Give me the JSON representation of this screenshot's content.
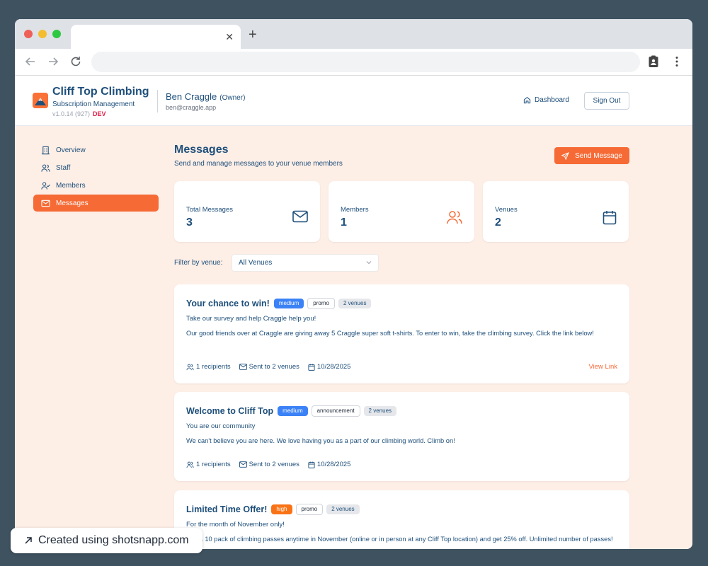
{
  "browser": {
    "tab_close": "✕",
    "new_tab": "+"
  },
  "header": {
    "brand_title": "Cliff Top Climbing",
    "brand_subtitle": "Subscription Management",
    "version": "v1.0.14 (927)",
    "env_badge": "DEV",
    "user_name": "Ben Craggle",
    "user_role": "(Owner)",
    "user_email": "ben@craggle.app",
    "dashboard_label": "Dashboard",
    "signout_label": "Sign Out"
  },
  "sidebar": {
    "items": [
      {
        "label": "Overview",
        "icon": "building-icon",
        "active": false
      },
      {
        "label": "Staff",
        "icon": "users-icon",
        "active": false
      },
      {
        "label": "Members",
        "icon": "user-check-icon",
        "active": false
      },
      {
        "label": "Messages",
        "icon": "mail-icon",
        "active": true
      }
    ]
  },
  "main": {
    "title": "Messages",
    "subtitle": "Send and manage messages to your venue members",
    "send_button": "Send Message",
    "stats": [
      {
        "label": "Total Messages",
        "value": "3",
        "icon": "mail-icon"
      },
      {
        "label": "Members",
        "value": "1",
        "icon": "users-icon"
      },
      {
        "label": "Venues",
        "value": "2",
        "icon": "calendar-icon"
      }
    ],
    "filter": {
      "label": "Filter by venue:",
      "selected": "All Venues"
    },
    "messages": [
      {
        "title": "Your chance to win!",
        "priority": "medium",
        "type": "promo",
        "venues": "2 venues",
        "subtitle": "Take our survey and help Craggle help you!",
        "body": "Our good friends over at Craggle are giving away 5 Craggle super soft t-shirts. To enter to win, take the climbing survey. Click the link below!",
        "recipients": "1 recipients",
        "sent_to": "Sent to 2 venues",
        "date": "10/28/2025",
        "link_label": "View Link"
      },
      {
        "title": "Welcome to Cliff Top",
        "priority": "medium",
        "type": "announcement",
        "venues": "2 venues",
        "subtitle": "You are our community",
        "body": "We can't believe you are here. We love having you as a part of our climbing world. Climb on!",
        "recipients": "1 recipients",
        "sent_to": "Sent to 2 venues",
        "date": "10/28/2025"
      },
      {
        "title": "Limited Time Offer!",
        "priority": "high",
        "type": "promo",
        "venues": "2 venues",
        "subtitle": "For the month of November only!",
        "body": "Buy a 10 pack of climbing passes anytime in November (online or in person at any Cliff Top location) and get 25% off. Unlimited number of passes!"
      }
    ]
  },
  "watermark": {
    "text": "Created using shotsnapp.com"
  },
  "colors": {
    "accent": "#f66a35",
    "navy": "#1e4f7a",
    "page_bg": "#fdeee6",
    "priority_medium": "#3b82f6",
    "priority_high": "#f97316"
  }
}
